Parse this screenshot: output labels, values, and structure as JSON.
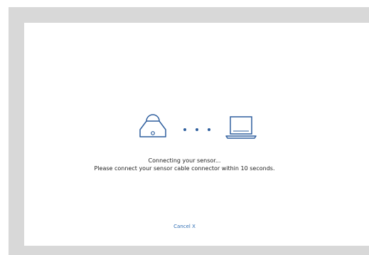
{
  "dialog": {
    "icons": [
      "sensor-icon",
      "connecting-dots-icon",
      "laptop-icon"
    ],
    "status_title": "Connecting your sensor...",
    "status_detail": "Please connect your sensor cable connector within 10 seconds.",
    "cancel_label": "Cancel X"
  },
  "colors": {
    "accent": "#2f6db3",
    "icon_stroke": "#2f5f9e",
    "frame_gray": "#d8d8d8"
  }
}
